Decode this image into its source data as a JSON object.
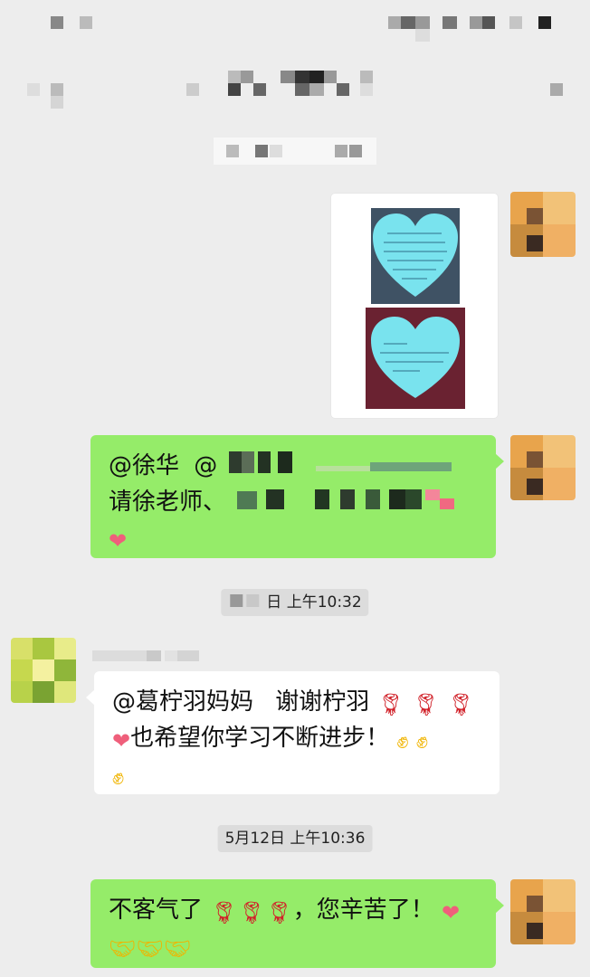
{
  "colors": {
    "background": "#ededed",
    "my_bubble": "#95ec69",
    "their_bubble": "#ffffff",
    "time_badge": "#dcdcdc"
  },
  "messages": [
    {
      "from": "me",
      "kind": "image",
      "image_desc_icon": "heart-notes-photo"
    },
    {
      "from": "me",
      "kind": "text",
      "line1_mention": "@徐华",
      "line1_mention2": "@",
      "line2_text": "请徐老师、",
      "trailing_icon": "heart-emoji"
    },
    {
      "from": "them",
      "kind": "text",
      "mention": "@葛柠羽妈妈",
      "thanks": "谢谢柠羽",
      "line2_text": "也希望你学习不断进步！",
      "icons": [
        "rose-emoji",
        "heart-emoji",
        "fist-emoji"
      ]
    },
    {
      "from": "me",
      "kind": "text",
      "text_a": "不客气了",
      "text_b": "，您辛苦了！",
      "icons": [
        "rose-emoji",
        "heart-emoji",
        "handshake-emoji"
      ]
    }
  ],
  "timestamps": {
    "first_suffix": "日 上午10:32",
    "second": "5月12日 上午10:36"
  }
}
